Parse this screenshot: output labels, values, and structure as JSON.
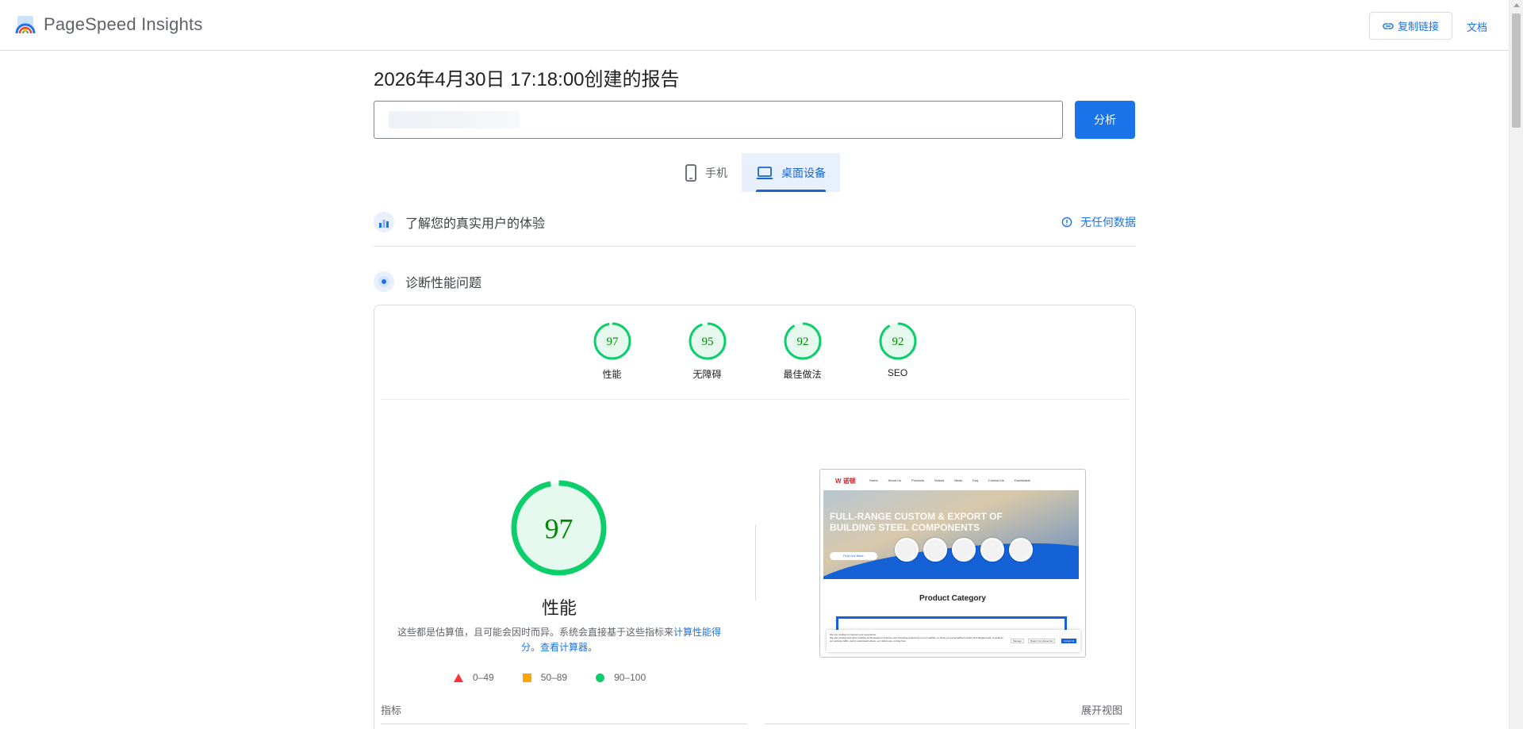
{
  "header": {
    "brand": "PageSpeed Insights",
    "copy_link": "复制链接",
    "docs": "文档"
  },
  "report": {
    "title": "2026年4月30日 17:18:00创建的报告",
    "url_value": "",
    "analyze": "分析"
  },
  "device_tabs": [
    {
      "label": "手机",
      "active": false
    },
    {
      "label": "桌面设备",
      "active": true
    }
  ],
  "field_data": {
    "label": "了解您的真实用户的体验",
    "no_data": "无任何数据"
  },
  "diagnose": {
    "label": "诊断性能问题"
  },
  "categories": [
    {
      "label": "性能",
      "score": "97"
    },
    {
      "label": "无障碍",
      "score": "95"
    },
    {
      "label": "最佳做法",
      "score": "92"
    },
    {
      "label": "SEO",
      "score": "92"
    }
  ],
  "performance": {
    "score": "97",
    "title": "性能",
    "note_prefix": "这些都是估算值，且可能会因时而异。系统会直接基于这些指标来",
    "note_link1": "计算性能得分",
    "note_sep": "。",
    "note_link2": "查看计算器",
    "note_end": "。"
  },
  "legend": [
    {
      "range": "0–49",
      "color": "#ff3333"
    },
    {
      "range": "50–89",
      "color": "#ffa400"
    },
    {
      "range": "90–100",
      "color": "#0cce6b"
    }
  ],
  "screenshot": {
    "logo": "W 诺顿",
    "menu": [
      "Home",
      "About Us",
      "Products",
      "Videos",
      "News",
      "Faq",
      "Contact Us",
      "Downloads"
    ],
    "headline_1": "FULL-RANGE CUSTOM & EXPORT OF",
    "headline_2": "BUILDING STEEL COMPONENTS",
    "cta": "Find Out More",
    "category_heading": "Product Category",
    "cookie_title": "We use cookies to improve your experience.",
    "cookie_text": "We use cookies and other tracking technologies to improve your browsing experience on our website, to show you personalized content and targeted ads, to analyze our website traffic, and to understand where our visitors are coming from.",
    "cookie_buttons": [
      "Manage",
      "Reject Non-Essential",
      "Accept All"
    ]
  },
  "metrics": {
    "label": "指标",
    "expand": "展开视图"
  },
  "colors": {
    "accent": "#1a73e8",
    "pass": "#0cce6b",
    "pass_fill": "#e6f9ee",
    "pass_text": "#008800"
  }
}
